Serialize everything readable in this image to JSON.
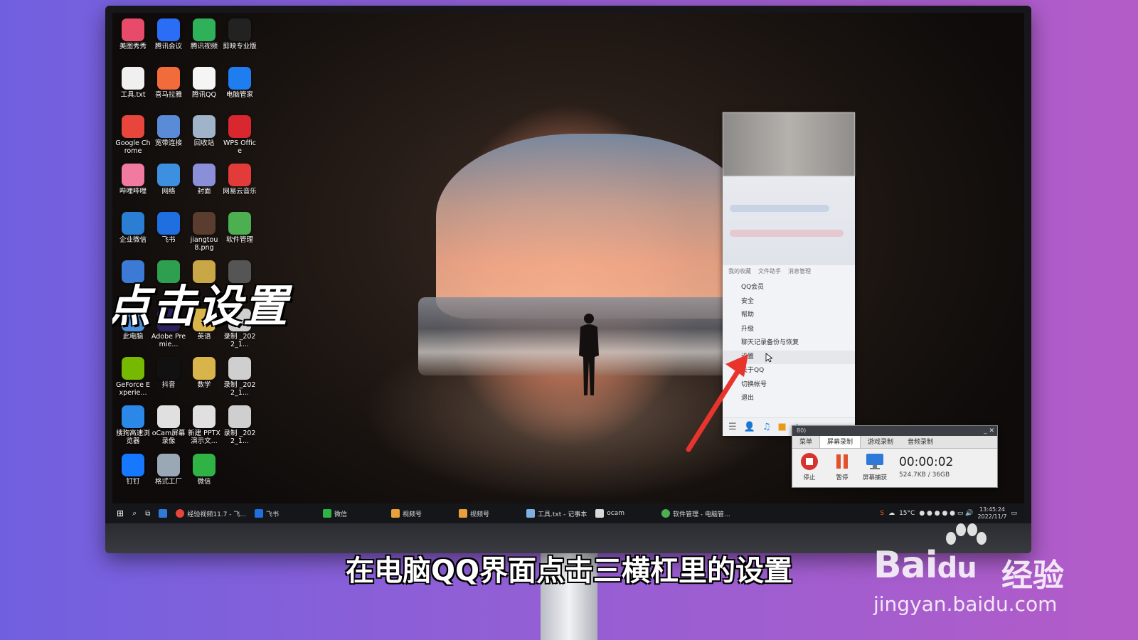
{
  "desktop_icons": [
    {
      "label": "美图秀秀",
      "color": "#e84a6a",
      "icon": "meitu-icon"
    },
    {
      "label": "腾讯会议",
      "color": "#2a6ef5",
      "icon": "tencent-meeting-icon"
    },
    {
      "label": "腾讯视频",
      "color": "#2fb15a",
      "icon": "tencent-video-icon"
    },
    {
      "label": "剪映专业版",
      "color": "#222222",
      "icon": "jianying-icon"
    },
    {
      "label": "工具.txt",
      "color": "#f0f0f0",
      "icon": "txt-file-icon"
    },
    {
      "label": "喜马拉雅",
      "color": "#f26b3a",
      "icon": "ximalaya-icon"
    },
    {
      "label": "腾讯QQ",
      "color": "#f5f5f5",
      "icon": "qq-icon"
    },
    {
      "label": "电脑管家",
      "color": "#1e7ef0",
      "icon": "pc-manager-icon"
    },
    {
      "label": "Google Chrome",
      "color": "#e8453c",
      "icon": "chrome-icon"
    },
    {
      "label": "宽带连接",
      "color": "#5a8bd6",
      "icon": "broadband-icon"
    },
    {
      "label": "回收站",
      "color": "#9fb4c9",
      "icon": "recycle-bin-icon"
    },
    {
      "label": "WPS Office",
      "color": "#d8272f",
      "icon": "wps-icon"
    },
    {
      "label": "哔哩哔哩",
      "color": "#f07aa0",
      "icon": "bilibili-icon"
    },
    {
      "label": "网络",
      "color": "#3d8fe0",
      "icon": "network-icon"
    },
    {
      "label": "封面",
      "color": "#8a8fd8",
      "icon": "cover-file-icon"
    },
    {
      "label": "网易云音乐",
      "color": "#e33a3a",
      "icon": "netease-music-icon"
    },
    {
      "label": "企业微信",
      "color": "#2a7fd4",
      "icon": "wecom-icon"
    },
    {
      "label": "飞书",
      "color": "#1f6fe0",
      "icon": "feishu-icon"
    },
    {
      "label": "jiangtou 8.png",
      "color": "#5a3d2e",
      "icon": "png-file-icon"
    },
    {
      "label": "软件管理",
      "color": "#4caf50",
      "icon": "software-manager-icon"
    },
    {
      "label": "",
      "color": "#3d7ad6",
      "icon": "settings-app-icon"
    },
    {
      "label": "",
      "color": "#2e9e4f",
      "icon": "spreadsheet-icon"
    },
    {
      "label": "",
      "color": "#c9a646",
      "icon": "folder-icon"
    },
    {
      "label": "",
      "color": "#555555",
      "icon": "file-icon"
    },
    {
      "label": "此电脑",
      "color": "#4d8fd8",
      "icon": "this-pc-icon"
    },
    {
      "label": "Adobe Premie...",
      "color": "#2b1f5c",
      "icon": "premiere-icon"
    },
    {
      "label": "英语",
      "color": "#d9b44a",
      "icon": "folder-english-icon"
    },
    {
      "label": "录制 _2022_1...",
      "color": "#cfcfcf",
      "icon": "video-file-icon"
    },
    {
      "label": "GeForce Experie...",
      "color": "#76b900",
      "icon": "geforce-icon"
    },
    {
      "label": "抖音",
      "color": "#111111",
      "icon": "douyin-icon"
    },
    {
      "label": "数学",
      "color": "#d9b44a",
      "icon": "folder-math-icon"
    },
    {
      "label": "录制 _2022_1...",
      "color": "#cfcfcf",
      "icon": "video-file-icon"
    },
    {
      "label": "搜狗高速浏览器",
      "color": "#2b88e6",
      "icon": "sogou-browser-icon"
    },
    {
      "label": "oCam屏幕录像",
      "color": "#e0e0e0",
      "icon": "ocam-icon"
    },
    {
      "label": "新建 PPTX 演示文...",
      "color": "#e0e0e0",
      "icon": "pptx-file-icon"
    },
    {
      "label": "录制 _2022_1...",
      "color": "#cfcfcf",
      "icon": "video-file-icon"
    },
    {
      "label": "钉钉",
      "color": "#1677ff",
      "icon": "dingtalk-icon"
    },
    {
      "label": "格式工厂",
      "color": "#9aa7b5",
      "icon": "format-factory-icon"
    },
    {
      "label": "微信",
      "color": "#2fb344",
      "icon": "wechat-icon"
    }
  ],
  "overlay": {
    "title": "点击设置"
  },
  "qq_panel": {
    "tabs": [
      "我的收藏",
      "文件助手",
      "消息管理"
    ],
    "menu": [
      {
        "label": "QQ会员",
        "highlight": false
      },
      {
        "label": "安全",
        "highlight": false
      },
      {
        "label": "帮助",
        "highlight": false
      },
      {
        "label": "升级",
        "highlight": false
      },
      {
        "label": "聊天记录备份与恢复",
        "highlight": false
      },
      {
        "label": "设置",
        "highlight": true
      },
      {
        "label": "关于QQ",
        "highlight": false
      },
      {
        "label": "切换帐号",
        "highlight": false
      },
      {
        "label": "退出",
        "highlight": false
      }
    ]
  },
  "ocam": {
    "title": "80)",
    "tabs": [
      "菜单",
      "屏幕录制",
      "游戏录制",
      "音频录制"
    ],
    "active_tab": 1,
    "buttons": [
      "停止",
      "暂停",
      "屏幕捕获"
    ],
    "timer": "00:00:02",
    "size": "524.7KB / 36GB"
  },
  "taskbar": {
    "items": [
      "经验视频11.7 - 飞...",
      "飞书",
      "微信",
      "视频号",
      "视频号",
      "工具.txt - 记事本",
      "ocam",
      "软件管理 - 电脑管..."
    ],
    "weather": "15°C",
    "time": "13:45:24",
    "date": "2022/11/7"
  },
  "subtitle": "在电脑QQ界面点击三横杠里的设置",
  "watermark": {
    "brand": "Bai",
    "brand2": "du",
    "cn": "经验",
    "url": "jingyan.baidu.com"
  }
}
